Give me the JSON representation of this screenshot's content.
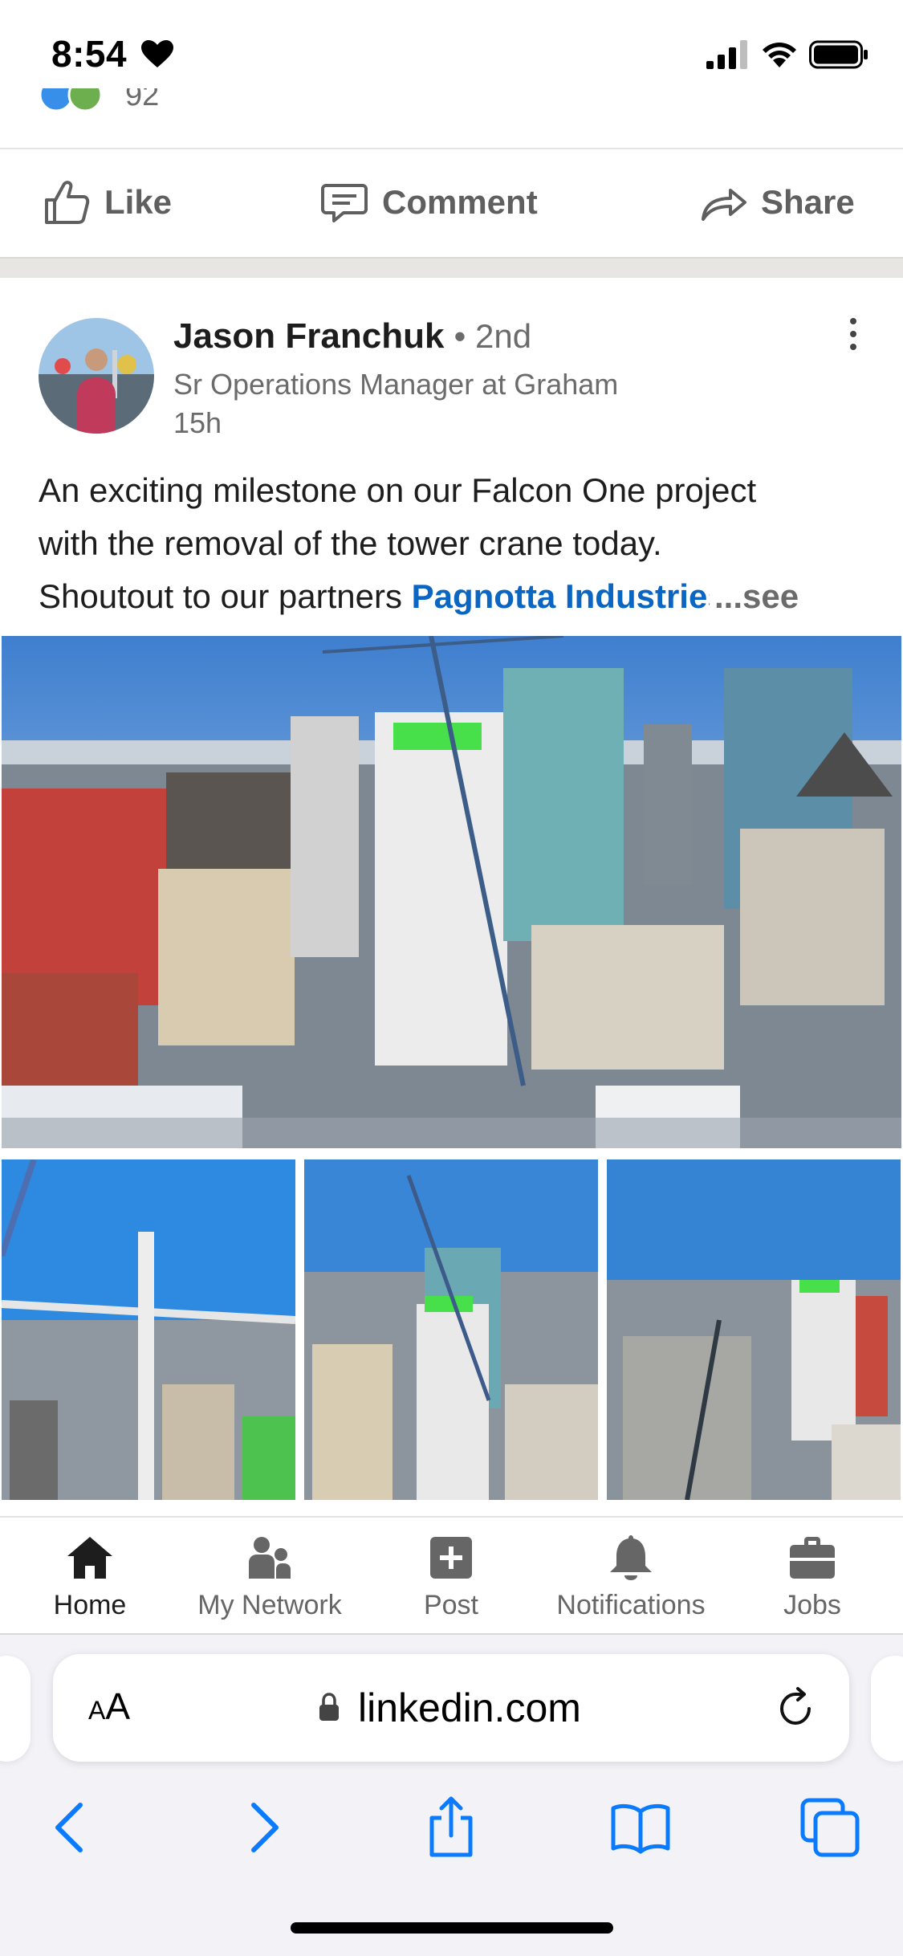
{
  "status_bar": {
    "time": "8:54"
  },
  "prev_post": {
    "reaction_count": "92",
    "actions": {
      "like": "Like",
      "comment": "Comment",
      "share": "Share"
    }
  },
  "post": {
    "author": "Jason Franchuk",
    "degree": "• 2nd",
    "headline": "Sr Operations Manager at Graham",
    "time": "15h",
    "text_line1": "An exciting milestone on our Falcon One project",
    "text_line2": "with the removal of the tower crane today.",
    "text_line3_prefix": "Shoutout to our partners ",
    "mention": "Pagnotta Industries",
    "see_more": "...see more"
  },
  "bottom_nav": {
    "home": "Home",
    "network": "My Network",
    "post": "Post",
    "notifications": "Notifications",
    "jobs": "Jobs"
  },
  "browser": {
    "aa_large": "A",
    "aa_small": "A",
    "url": "linkedin.com"
  },
  "colors": {
    "link_blue": "#0a66c2",
    "ios_blue": "#0a7aff",
    "gap_gray": "#e8e6e2"
  },
  "icons": [
    "heart-icon",
    "signal-icon",
    "wifi-icon",
    "battery-icon",
    "like-icon",
    "comment-icon",
    "share-icon",
    "more-icon",
    "home-icon",
    "network-icon",
    "post-plus-icon",
    "bell-icon",
    "briefcase-icon",
    "lock-icon",
    "reload-icon",
    "back-icon",
    "forward-icon",
    "share-sheet-icon",
    "bookmarks-icon",
    "tabs-icon"
  ]
}
